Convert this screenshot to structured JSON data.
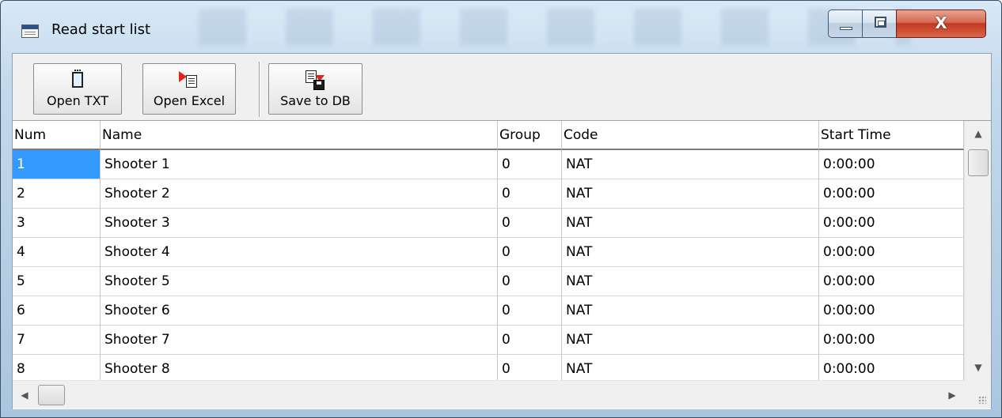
{
  "window": {
    "title": "Read start list",
    "controls": {
      "minimize_icon": "minimize-icon",
      "maximize_icon": "maximize-icon",
      "close_icon": "close-icon",
      "close_glyph": "X"
    },
    "accent_close": "#c7482c"
  },
  "toolbar": {
    "buttons": [
      {
        "label": "Open TXT",
        "icon": "notepad-icon"
      },
      {
        "label": "Open Excel",
        "icon": "open-excel-icon"
      },
      {
        "label": "Save to DB",
        "icon": "save-to-db-icon"
      }
    ]
  },
  "grid": {
    "columns": [
      "Num",
      "Name",
      "Group",
      "Code",
      "Start Time"
    ],
    "rows": [
      [
        "1",
        "Shooter 1",
        "0",
        "NAT",
        "0:00:00"
      ],
      [
        "2",
        "Shooter 2",
        "0",
        "NAT",
        "0:00:00"
      ],
      [
        "3",
        "Shooter 3",
        "0",
        "NAT",
        "0:00:00"
      ],
      [
        "4",
        "Shooter 4",
        "0",
        "NAT",
        "0:00:00"
      ],
      [
        "5",
        "Shooter 5",
        "0",
        "NAT",
        "0:00:00"
      ],
      [
        "6",
        "Shooter 6",
        "0",
        "NAT",
        "0:00:00"
      ],
      [
        "7",
        "Shooter 7",
        "0",
        "NAT",
        "0:00:00"
      ],
      [
        "8",
        "Shooter 8",
        "0",
        "NAT",
        "0:00:00"
      ]
    ],
    "selected_cell": {
      "row": 0,
      "column": 0
    },
    "selection_color": "#3399ff"
  },
  "scrollbars": {
    "up_arrow": "▲",
    "down_arrow": "▼",
    "left_arrow": "◀",
    "right_arrow": "▶"
  }
}
